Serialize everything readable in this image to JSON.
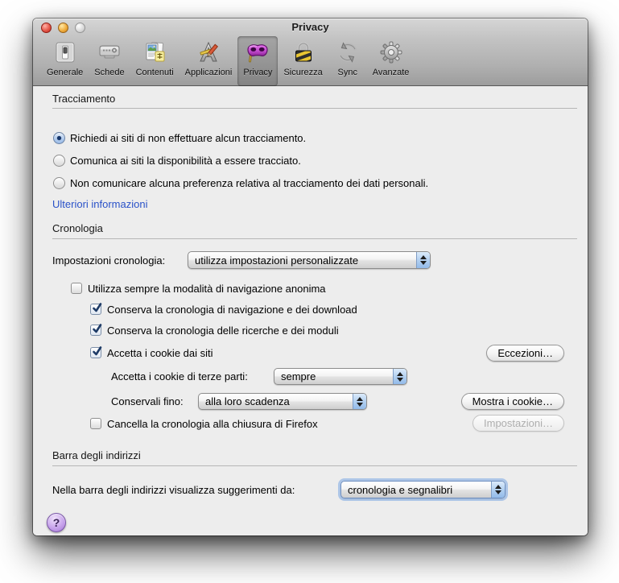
{
  "window": {
    "title": "Privacy"
  },
  "toolbar": {
    "items": [
      {
        "label": "Generale",
        "icon": "switch-icon",
        "selected": false
      },
      {
        "label": "Schede",
        "icon": "tab-icon",
        "selected": false
      },
      {
        "label": "Contenuti",
        "icon": "content-page-icon",
        "selected": false
      },
      {
        "label": "Applicazioni",
        "icon": "applications-icon",
        "selected": false
      },
      {
        "label": "Privacy",
        "icon": "mask-icon",
        "selected": true
      },
      {
        "label": "Sicurezza",
        "icon": "lock-icon",
        "selected": false
      },
      {
        "label": "Sync",
        "icon": "sync-icon",
        "selected": false
      },
      {
        "label": "Avanzate",
        "icon": "gear-icon",
        "selected": false
      }
    ]
  },
  "tracking": {
    "section_title": "Tracciamento",
    "options": [
      {
        "label": "Richiedi ai siti di non effettuare alcun tracciamento.",
        "selected": true
      },
      {
        "label": "Comunica ai siti la disponibilità a essere tracciato.",
        "selected": false
      },
      {
        "label": "Non comunicare alcuna preferenza relativa al tracciamento dei dati personali.",
        "selected": false
      }
    ],
    "more_info_link": "Ulteriori informazioni"
  },
  "history": {
    "section_title": "Cronologia",
    "settings_label": "Impostazioni cronologia:",
    "settings_value": "utilizza impostazioni personalizzate",
    "checkboxes": [
      {
        "label": "Utilizza sempre la modalità di navigazione anonima",
        "checked": false
      },
      {
        "label": "Conserva la cronologia di navigazione e dei download",
        "checked": true
      },
      {
        "label": "Conserva la cronologia delle ricerche e dei moduli",
        "checked": true
      },
      {
        "label": "Accetta i cookie dai siti",
        "checked": true
      },
      {
        "label": "Cancella la cronologia alla chiusura di Firefox",
        "checked": false
      }
    ],
    "third_party_label": "Accetta i cookie di terze parti:",
    "third_party_value": "sempre",
    "keep_until_label": "Conservali fino:",
    "keep_until_value": "alla loro scadenza",
    "exceptions_button": "Eccezioni…",
    "show_cookies_button": "Mostra i cookie…",
    "settings_button": "Impostazioni…",
    "settings_button_disabled": true
  },
  "address_bar": {
    "section_title": "Barra degli indirizzi",
    "suggest_label": "Nella barra degli indirizzi visualizza suggerimenti da:",
    "suggest_value": "cronologia e segnalibri"
  },
  "help": {
    "label": "?"
  },
  "colors": {
    "accent_blue_stepper": "#92bbea",
    "link_blue": "#2a52c8",
    "privacy_mask_purple": "#c44ecf",
    "help_purple": "#c8a4ec"
  }
}
